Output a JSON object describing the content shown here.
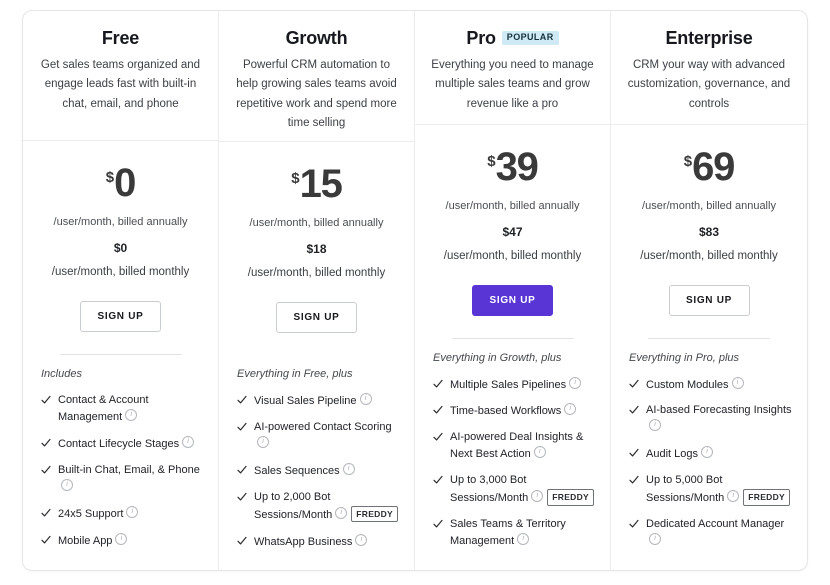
{
  "plans": [
    {
      "name": "Free",
      "badge": null,
      "description": "Get sales teams organized and engage leads fast with built-in chat, email, and phone",
      "currency": "$",
      "price_annual": "0",
      "period_annual": "/user/month, billed annually",
      "price_monthly": "$0",
      "period_monthly": "/user/month, billed monthly",
      "cta_label": "SIGN UP",
      "cta_primary": false,
      "features_intro": "Includes",
      "features": [
        {
          "text": "Contact & Account Management",
          "info": true,
          "freddy": false
        },
        {
          "text": "Contact Lifecycle Stages",
          "info": true,
          "freddy": false
        },
        {
          "text": "Built-in Chat, Email, & Phone",
          "info": true,
          "freddy": false
        },
        {
          "text": "24x5 Support",
          "info": true,
          "freddy": false
        },
        {
          "text": "Mobile App",
          "info": true,
          "freddy": false
        }
      ]
    },
    {
      "name": "Growth",
      "badge": null,
      "description": "Powerful CRM automation to help growing sales teams avoid repetitive work and spend more time selling",
      "currency": "$",
      "price_annual": "15",
      "period_annual": "/user/month, billed annually",
      "price_monthly": "$18",
      "period_monthly": "/user/month, billed monthly",
      "cta_label": "SIGN UP",
      "cta_primary": false,
      "features_intro": "Everything in Free, plus",
      "features": [
        {
          "text": "Visual Sales Pipeline",
          "info": true,
          "freddy": false
        },
        {
          "text": "AI-powered Contact Scoring",
          "info": true,
          "freddy": false
        },
        {
          "text": "Sales Sequences",
          "info": true,
          "freddy": false
        },
        {
          "text": "Up to 2,000 Bot Sessions/Month",
          "info": true,
          "freddy": true
        },
        {
          "text": "WhatsApp Business",
          "info": true,
          "freddy": false
        }
      ]
    },
    {
      "name": "Pro",
      "badge": "POPULAR",
      "description": "Everything you need to manage multiple sales teams and grow revenue like a pro",
      "currency": "$",
      "price_annual": "39",
      "period_annual": "/user/month, billed annually",
      "price_monthly": "$47",
      "period_monthly": "/user/month, billed monthly",
      "cta_label": "SIGN UP",
      "cta_primary": true,
      "features_intro": "Everything in Growth, plus",
      "features": [
        {
          "text": "Multiple Sales Pipelines",
          "info": true,
          "freddy": false
        },
        {
          "text": "Time-based Workflows",
          "info": true,
          "freddy": false
        },
        {
          "text": "AI-powered Deal Insights & Next Best Action",
          "info": true,
          "freddy": false
        },
        {
          "text": "Up to 3,000 Bot Sessions/Month",
          "info": true,
          "freddy": true
        },
        {
          "text": "Sales Teams & Territory Management",
          "info": true,
          "freddy": false
        }
      ]
    },
    {
      "name": "Enterprise",
      "badge": null,
      "description": "CRM your way with advanced customization, governance, and controls",
      "currency": "$",
      "price_annual": "69",
      "period_annual": "/user/month, billed annually",
      "price_monthly": "$83",
      "period_monthly": "/user/month, billed monthly",
      "cta_label": "SIGN UP",
      "cta_primary": false,
      "features_intro": "Everything in Pro, plus",
      "features": [
        {
          "text": "Custom Modules",
          "info": true,
          "freddy": false
        },
        {
          "text": "AI-based Forecasting Insights",
          "info": true,
          "freddy": false
        },
        {
          "text": "Audit Logs",
          "info": true,
          "freddy": false
        },
        {
          "text": "Up to 5,000 Bot Sessions/Month",
          "info": true,
          "freddy": true
        },
        {
          "text": "Dedicated Account Manager",
          "info": true,
          "freddy": false
        }
      ]
    }
  ],
  "labels": {
    "freddy_badge": "FREDDY",
    "check_icon": "check-icon",
    "info_icon": "info-icon"
  },
  "colors": {
    "primary_cta": "#5a35d6",
    "popular_badge_bg": "#cfeaf4",
    "border": "#ececec"
  }
}
